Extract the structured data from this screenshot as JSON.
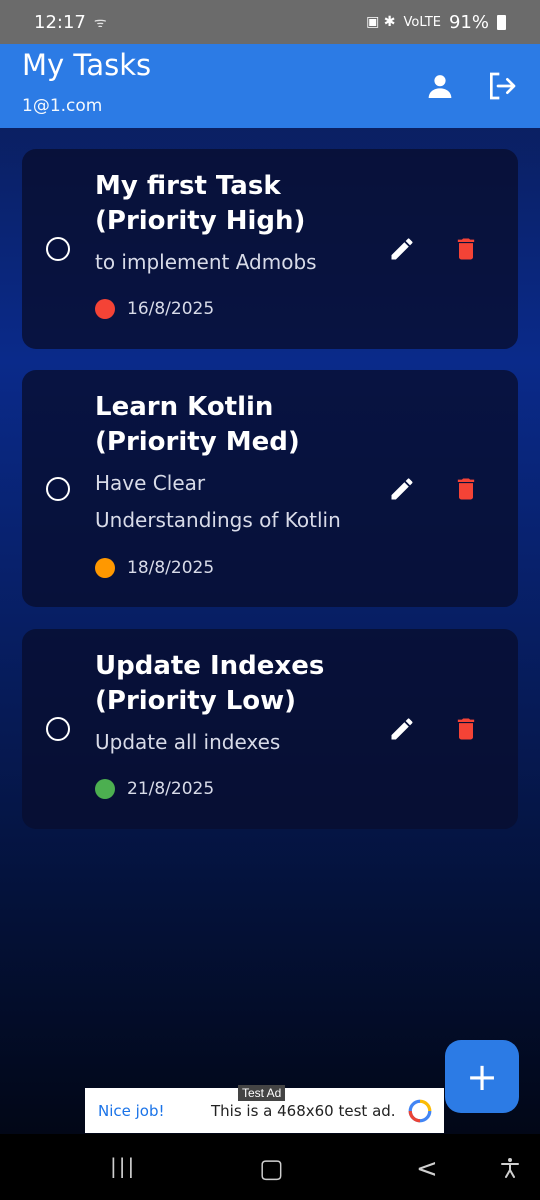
{
  "status": {
    "time": "12:17",
    "signal_left": "ᯤ",
    "right_icons": "▣ ✱ ",
    "lte": "VoLTE",
    "battery": "91%"
  },
  "appbar": {
    "title": "My Tasks",
    "subtitle": "1@1.com",
    "profile_icon": "person-icon",
    "logout_icon": "logout-icon"
  },
  "tasks": [
    {
      "title_line1": "My first Task",
      "title_line2": "(Priority High)",
      "desc_line1": "to implement Admobs",
      "desc_line2": "",
      "date": "16/8/2025",
      "priority_color": "#f44336"
    },
    {
      "title_line1": "Learn Kotlin",
      "title_line2": "(Priority Med)",
      "desc_line1": "Have Clear",
      "desc_line2": "Understandings of Kotlin",
      "date": "18/8/2025",
      "priority_color": "#ff9800"
    },
    {
      "title_line1": "Update Indexes",
      "title_line2": "(Priority Low)",
      "desc_line1": "Update all indexes",
      "desc_line2": "",
      "date": "21/8/2025",
      "priority_color": "#4caf50"
    }
  ],
  "colors": {
    "accent": "#2c7be5",
    "delete": "#f44336"
  },
  "fab": {
    "label": "+"
  },
  "ad": {
    "label": "Test Ad",
    "nice": "Nice job!",
    "text": "This is a 468x60 test ad."
  },
  "nav": {
    "recents": "|||",
    "home": "▢",
    "back": "<",
    "accessibility": "accessibility-icon"
  }
}
